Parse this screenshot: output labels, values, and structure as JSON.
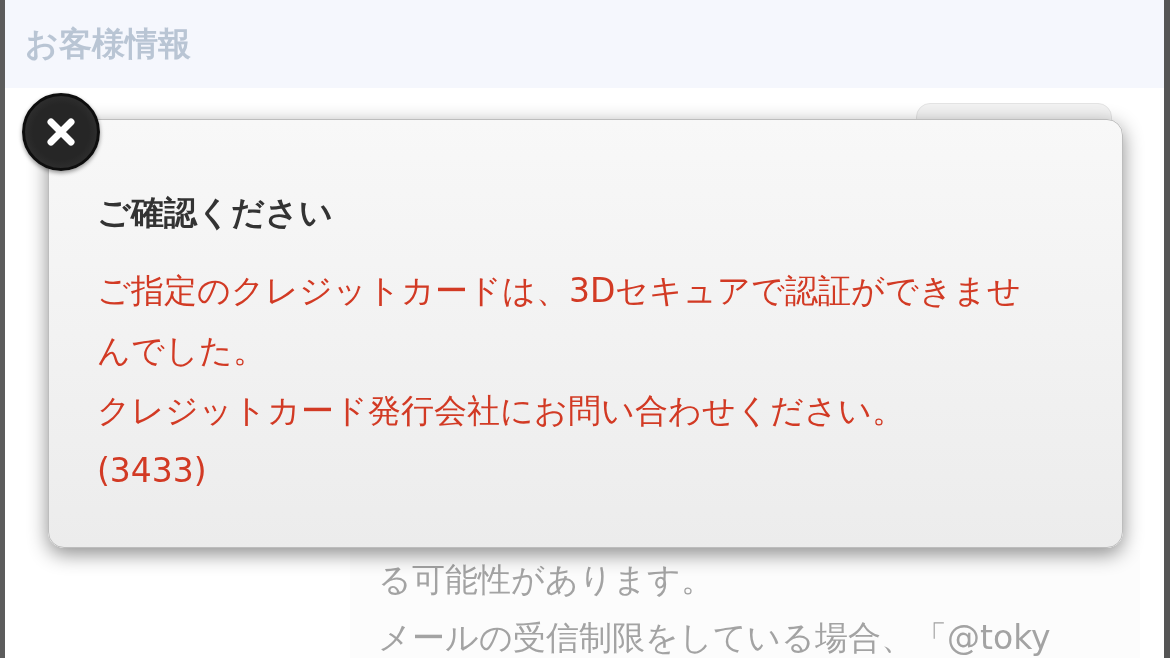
{
  "page": {
    "title": "お客様情報",
    "notice_lines": [
      "る可能性があります。",
      "メールの受信制限をしている場合、「@toky"
    ]
  },
  "dialog": {
    "title": "ご確認ください",
    "message_lines": [
      "ご指定のクレジットカードは、3Dセキュアで認証ができませんでした。",
      "クレジットカード発行会社にお問い合わせください。",
      "(3433)"
    ]
  }
}
